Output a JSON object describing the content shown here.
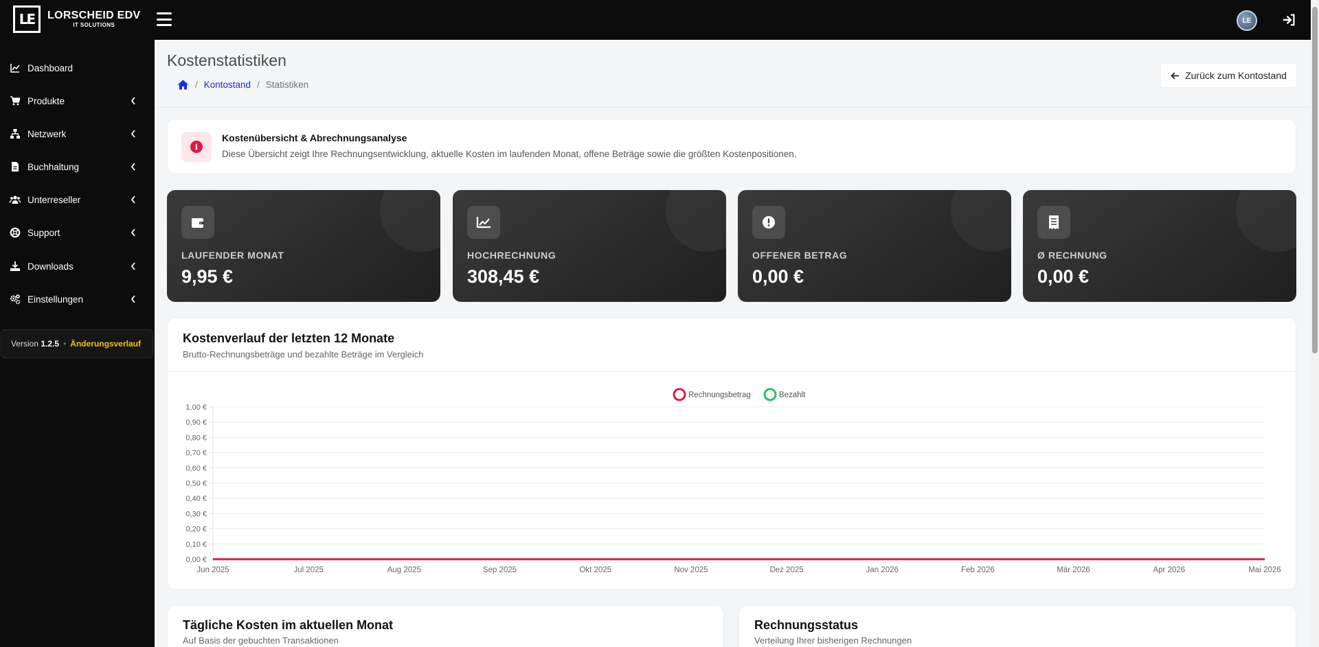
{
  "brand": {
    "logo_text": "LE",
    "name": "LORSCHEID EDV",
    "sub": "IT SOLUTIONS"
  },
  "header": {
    "avatar_text": "LE"
  },
  "sidebar": {
    "items": [
      {
        "label": "Dashboard",
        "icon": "chart-line-icon",
        "has_children": false
      },
      {
        "label": "Produkte",
        "icon": "cart-icon",
        "has_children": true
      },
      {
        "label": "Netzwerk",
        "icon": "network-icon",
        "has_children": true
      },
      {
        "label": "Buchhaltung",
        "icon": "invoice-icon",
        "has_children": true
      },
      {
        "label": "Unterreseller",
        "icon": "users-icon",
        "has_children": true
      },
      {
        "label": "Support",
        "icon": "lifebuoy-icon",
        "has_children": true
      },
      {
        "label": "Downloads",
        "icon": "download-icon",
        "has_children": true
      },
      {
        "label": "Einstellungen",
        "icon": "gears-icon",
        "has_children": true
      }
    ],
    "version_prefix": "Version",
    "version_number": "1.2.5",
    "changelog_label": "Änderungsverlauf"
  },
  "page": {
    "title": "Kostenstatistiken",
    "breadcrumb": {
      "parent": "Kontostand",
      "current": "Statistiken"
    },
    "back_button": "Zurück zum Kontostand"
  },
  "info": {
    "title": "Kostenübersicht & Abrechnungsanalyse",
    "text": "Diese Übersicht zeigt Ihre Rechnungsentwicklung, aktuelle Kosten im laufenden Monat, offene Beträge sowie die größten Kostenpositionen."
  },
  "stats": [
    {
      "label": "LAUFENDER MONAT",
      "value": "9,95 €",
      "icon": "wallet-icon"
    },
    {
      "label": "HOCHRECHNUNG",
      "value": "308,45 €",
      "icon": "trend-icon"
    },
    {
      "label": "OFFENER BETRAG",
      "value": "0,00 €",
      "icon": "alert-icon"
    },
    {
      "label": "Ø RECHNUNG",
      "value": "0,00 €",
      "icon": "receipt-icon"
    }
  ],
  "cost_chart": {
    "title": "Kostenverlauf der letzten 12 Monate",
    "subtitle": "Brutto-Rechnungsbeträge und bezahlte Beträge im Vergleich"
  },
  "daily_card": {
    "title": "Tägliche Kosten im aktuellen Monat",
    "subtitle": "Auf Basis der gebuchten Transaktionen"
  },
  "status_card": {
    "title": "Rechnungsstatus",
    "subtitle": "Verteilung Ihrer bisherigen Rechnungen"
  },
  "colors": {
    "invoice": "#dd1a45",
    "paid": "#22c55e",
    "sidebar_bg": "#0c0c0c",
    "accent_yellow": "#f2c21b",
    "link_blue": "#1a2fd6"
  },
  "chart_data": {
    "type": "line",
    "title": "",
    "xlabel": "",
    "ylabel": "",
    "categories": [
      "Jun 2025",
      "Jul 2025",
      "Aug 2025",
      "Sep 2025",
      "Okt 2025",
      "Nov 2025",
      "Dez 2025",
      "Jan 2026",
      "Feb 2026",
      "Mär 2026",
      "Apr 2026",
      "Mai 2026"
    ],
    "series": [
      {
        "name": "Rechnungsbetrag",
        "color": "#dd1a45",
        "values": [
          0,
          0,
          0,
          0,
          0,
          0,
          0,
          0,
          0,
          0,
          0,
          0
        ]
      },
      {
        "name": "Bezahlt",
        "color": "#22c55e",
        "values": [
          0,
          0,
          0,
          0,
          0,
          0,
          0,
          0,
          0,
          0,
          0,
          0
        ]
      }
    ],
    "ylim": [
      0,
      1
    ],
    "yticks": [
      "0,00 €",
      "0,10 €",
      "0,20 €",
      "0,30 €",
      "0,40 €",
      "0,50 €",
      "0,60 €",
      "0,70 €",
      "0,80 €",
      "0,90 €",
      "1,00 €"
    ],
    "grid": true,
    "legend": "top-center"
  }
}
